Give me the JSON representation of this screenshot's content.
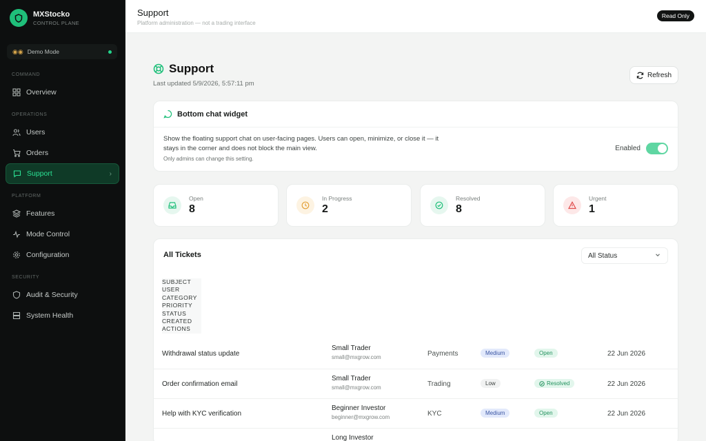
{
  "brand": {
    "name": "MXStocko",
    "subtitle": "CONTROL PLANE"
  },
  "demo_mode": {
    "label": "Demo Mode"
  },
  "sidebar": {
    "sections": [
      "COMMAND",
      "OPERATIONS",
      "PLATFORM",
      "SECURITY"
    ],
    "items": [
      {
        "label": "Overview",
        "icon": "grid-icon"
      },
      {
        "label": "Users",
        "icon": "users-icon"
      },
      {
        "label": "Orders",
        "icon": "cart-icon"
      },
      {
        "label": "Support",
        "icon": "chat-icon",
        "active": true
      },
      {
        "label": "Features",
        "icon": "layers-icon"
      },
      {
        "label": "Mode Control",
        "icon": "activity-icon"
      },
      {
        "label": "Configuration",
        "icon": "gear-icon"
      },
      {
        "label": "Audit & Security",
        "icon": "shield-icon"
      },
      {
        "label": "System Health",
        "icon": "server-icon"
      }
    ]
  },
  "topbar": {
    "title": "Support",
    "subtitle": "Platform administration — not a trading interface",
    "badge": "Read Only"
  },
  "page": {
    "title": "Support",
    "updated": "Last updated 5/9/2026, 5:57:11 pm",
    "refresh_label": "Refresh"
  },
  "widget": {
    "title": "Bottom chat widget",
    "description": "Show the floating support chat on user-facing pages. Users can open, minimize, or close it — it stays in the corner and does not block the main view.",
    "note": "Only admins can change this setting.",
    "toggle_label": "Enabled",
    "enabled": true
  },
  "stats": [
    {
      "label": "Open",
      "value": "8",
      "color": "#1fbf7a"
    },
    {
      "label": "In Progress",
      "value": "2",
      "color": "#e3a23b"
    },
    {
      "label": "Resolved",
      "value": "8",
      "color": "#1fbf7a"
    },
    {
      "label": "Urgent",
      "value": "1",
      "color": "#e04b4b"
    }
  ],
  "tickets": {
    "title": "All Tickets",
    "filter_value": "All Status",
    "columns": [
      "SUBJECT",
      "USER",
      "CATEGORY",
      "PRIORITY",
      "STATUS",
      "CREATED",
      "ACTIONS"
    ],
    "rows": [
      {
        "subject": "Withdrawal status update",
        "user": "Small Trader",
        "email": "small@mxgrow.com",
        "category": "Payments",
        "priority": "Medium",
        "status": "Open",
        "created": "22 Jun 2026"
      },
      {
        "subject": "Order confirmation email",
        "user": "Small Trader",
        "email": "small@mxgrow.com",
        "category": "Trading",
        "priority": "Low",
        "status": "Resolved",
        "created": "22 Jun 2026"
      },
      {
        "subject": "Help with KYC verification",
        "user": "Beginner Investor",
        "email": "beginner@mxgrow.com",
        "category": "KYC",
        "priority": "Medium",
        "status": "Open",
        "created": "22 Jun 2026"
      },
      {
        "subject": "",
        "user": "Long Investor",
        "email": "",
        "category": "",
        "priority": "",
        "status": "",
        "created": ""
      }
    ]
  }
}
